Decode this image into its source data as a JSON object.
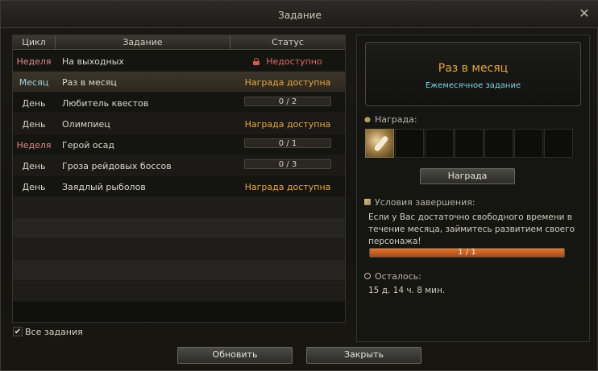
{
  "window": {
    "title": "Задание",
    "close_icon": "close-icon"
  },
  "table": {
    "headers": {
      "cycle": "Цикл",
      "quest": "Задание",
      "status": "Статус"
    },
    "rows": [
      {
        "cycle": "Неделя",
        "cycle_type": "week",
        "name": "На выходных",
        "status_type": "locked",
        "status": "Недоступно"
      },
      {
        "cycle": "Месяц",
        "cycle_type": "month",
        "name": "Раз в месяц",
        "status_type": "available",
        "status": "Награда доступна",
        "selected": true
      },
      {
        "cycle": "День",
        "cycle_type": "day",
        "name": "Любитель квестов",
        "status_type": "progress",
        "status": "0 / 2",
        "progress": 0
      },
      {
        "cycle": "День",
        "cycle_type": "day",
        "name": "Олимпиец",
        "status_type": "available",
        "status": "Награда доступна"
      },
      {
        "cycle": "Неделя",
        "cycle_type": "week",
        "name": "Герой осад",
        "status_type": "progress",
        "status": "0 / 1",
        "progress": 0
      },
      {
        "cycle": "День",
        "cycle_type": "day",
        "name": "Гроза рейдовых боссов",
        "status_type": "progress",
        "status": "0 / 3",
        "progress": 0
      },
      {
        "cycle": "День",
        "cycle_type": "day",
        "name": "Заядлый рыболов",
        "status_type": "available",
        "status": "Награда доступна"
      }
    ],
    "empty_rows": 5
  },
  "filter": {
    "all_quests_label": "Все задания",
    "checked": true
  },
  "details": {
    "title": "Раз в месяц",
    "subtitle": "Ежемесячное задание",
    "reward_label": "Награда:",
    "reward_slots": 7,
    "reward_button": "Награда",
    "conditions_label": "Условия завершения:",
    "conditions_text": "Если у Вас достаточно свободного времени в течение месяца, займитесь развитием своего персонажа!",
    "progress_text": "1 / 1",
    "progress_fraction": 1.0,
    "remaining_label": "Осталось:",
    "remaining_value": "15 д. 14 ч. 8 мин."
  },
  "buttons": {
    "refresh": "Обновить",
    "close": "Закрыть"
  },
  "colors": {
    "accent_gold": "#e6a73b",
    "week": "#e08a8a",
    "month": "#9fd2e0",
    "locked": "#e06a5a",
    "subtitle": "#7fd3e3"
  }
}
